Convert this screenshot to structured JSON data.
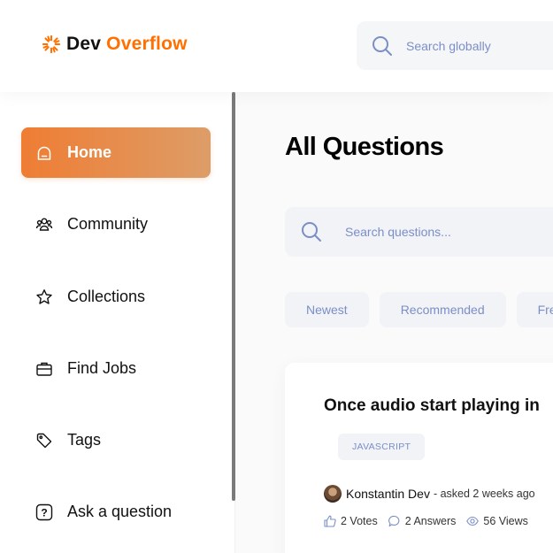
{
  "header": {
    "logo_part1": "Dev",
    "logo_part2": "Overflow",
    "global_search_placeholder": "Search globally"
  },
  "colors": {
    "brand": "#ff7000",
    "active_gradient_start": "#ef7d33",
    "active_gradient_end": "#dd9d68",
    "muted_text": "#7b8ec8"
  },
  "sidebar": {
    "items": [
      {
        "label": "Home",
        "icon": "home-icon",
        "active": true
      },
      {
        "label": "Community",
        "icon": "users-icon",
        "active": false
      },
      {
        "label": "Collections",
        "icon": "star-icon",
        "active": false
      },
      {
        "label": "Find Jobs",
        "icon": "briefcase-icon",
        "active": false
      },
      {
        "label": "Tags",
        "icon": "tag-icon",
        "active": false
      },
      {
        "label": "Ask a question",
        "icon": "question-icon",
        "active": false
      }
    ]
  },
  "main": {
    "title": "All Questions",
    "search_placeholder": "Search questions...",
    "filters": [
      "Newest",
      "Recommended",
      "Frequent"
    ],
    "question": {
      "title": "Once audio start playing in",
      "tags": [
        "JAVASCRIPT"
      ],
      "author": "Konstantin Dev",
      "asked": "- asked 2 weeks ago",
      "votes": "2 Votes",
      "answers": "2 Answers",
      "views": "56 Views"
    }
  }
}
